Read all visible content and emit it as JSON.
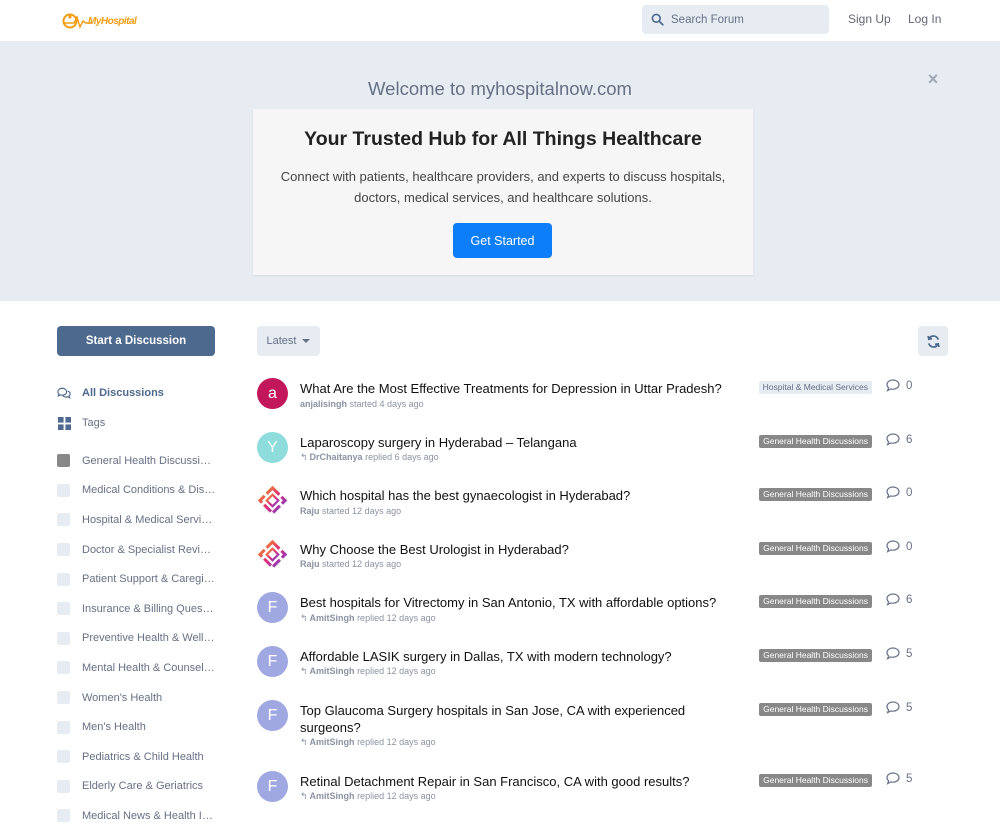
{
  "header": {
    "logo_text": "MyHospital",
    "search_placeholder": "Search Forum",
    "signup": "Sign Up",
    "login": "Log In"
  },
  "hero": {
    "welcome": "Welcome to myhospitalnow.com",
    "close": "×",
    "heading": "Your Trusted Hub for All Things Healthcare",
    "description": "Connect with patients, healthcare providers, and experts to discuss hospitals, doctors, medical services, and healthcare solutions.",
    "cta": "Get Started"
  },
  "sidebar": {
    "start_button": "Start a Discussion",
    "nav": [
      {
        "label": "All Discussions",
        "icon": "comments-icon"
      },
      {
        "label": "Tags",
        "icon": "tags-grid-icon"
      }
    ],
    "tags": [
      "General Health Discussions",
      "Medical Conditions & Diseases",
      "Hospital & Medical Services",
      "Doctor & Specialist Reviews",
      "Patient Support & Caregiving",
      "Insurance & Billing Questions",
      "Preventive Health & Wellness",
      "Mental Health & Counseling",
      "Women's Health",
      "Men's Health",
      "Pediatrics & Child Health",
      "Elderly Care & Geriatrics",
      "Medical News & Health Innovations"
    ],
    "tags_display": [
      "General Health Discussions",
      "Medical Conditions & Dis…",
      "Hospital & Medical Services",
      "Doctor & Specialist Reviews",
      "Patient Support & Caregiv…",
      "Insurance & Billing Questi…",
      "Preventive Health & Welln…",
      "Mental Health & Counseli…",
      "Women's Health",
      "Men's Health",
      "Pediatrics & Child Health",
      "Elderly Care & Geriatrics",
      "Medical News & Health In…"
    ]
  },
  "toolbar": {
    "sort_label": "Latest"
  },
  "discussions": [
    {
      "avatar": "a",
      "avatar_color": "#c2185b",
      "title": "What Are the Most Effective Treatments for Depression in Uttar Pradesh?",
      "user": "anjalisingh",
      "action": "started 4 days ago",
      "reply": false,
      "tag": "Hospital & Medical Services",
      "tag_style": "light",
      "count": "0"
    },
    {
      "avatar": "Y",
      "avatar_color": "#8fdcdc",
      "title": "Laparoscopy surgery in Hyderabad – Telangana",
      "user": "DrChaitanya",
      "action": "replied 6 days ago",
      "reply": true,
      "tag": "General Health Discussions",
      "tag_style": "dark",
      "count": "6"
    },
    {
      "avatar": "",
      "avatar_color": "logo",
      "title": "Which hospital has the best gynaecologist in Hyderabad?",
      "user": "Raju",
      "action": "started 12 days ago",
      "reply": false,
      "tag": "General Health Discussions",
      "tag_style": "dark",
      "count": "0"
    },
    {
      "avatar": "",
      "avatar_color": "logo",
      "title": "Why Choose the Best Urologist in Hyderabad?",
      "user": "Raju",
      "action": "started 12 days ago",
      "reply": false,
      "tag": "General Health Discussions",
      "tag_style": "dark",
      "count": "0"
    },
    {
      "avatar": "F",
      "avatar_color": "#9fa8e0",
      "title": "Best hospitals for Vitrectomy in San Antonio, TX with affordable options?",
      "user": "AmitSingh",
      "action": "replied 12 days ago",
      "reply": true,
      "tag": "General Health Discussions",
      "tag_style": "dark",
      "count": "6"
    },
    {
      "avatar": "F",
      "avatar_color": "#9fa8e0",
      "title": "Affordable LASIK surgery in Dallas, TX with modern technology?",
      "user": "AmitSingh",
      "action": "replied 12 days ago",
      "reply": true,
      "tag": "General Health Discussions",
      "tag_style": "dark",
      "count": "5"
    },
    {
      "avatar": "F",
      "avatar_color": "#9fa8e0",
      "title": "Top Glaucoma Surgery hospitals in San Jose, CA with experienced surgeons?",
      "user": "AmitSingh",
      "action": "replied 12 days ago",
      "reply": true,
      "tag": "General Health Discussions",
      "tag_style": "dark",
      "count": "5"
    },
    {
      "avatar": "F",
      "avatar_color": "#9fa8e0",
      "title": "Retinal Detachment Repair in San Francisco, CA with good results?",
      "user": "AmitSingh",
      "action": "replied 12 days ago",
      "reply": true,
      "tag": "General Health Discussions",
      "tag_style": "dark",
      "count": "5"
    }
  ],
  "colors": {
    "primary": "#0d7ef9",
    "sidebar_button": "#4d698e",
    "hero_bg": "#e7ecf3",
    "logo": "#f39c12"
  }
}
